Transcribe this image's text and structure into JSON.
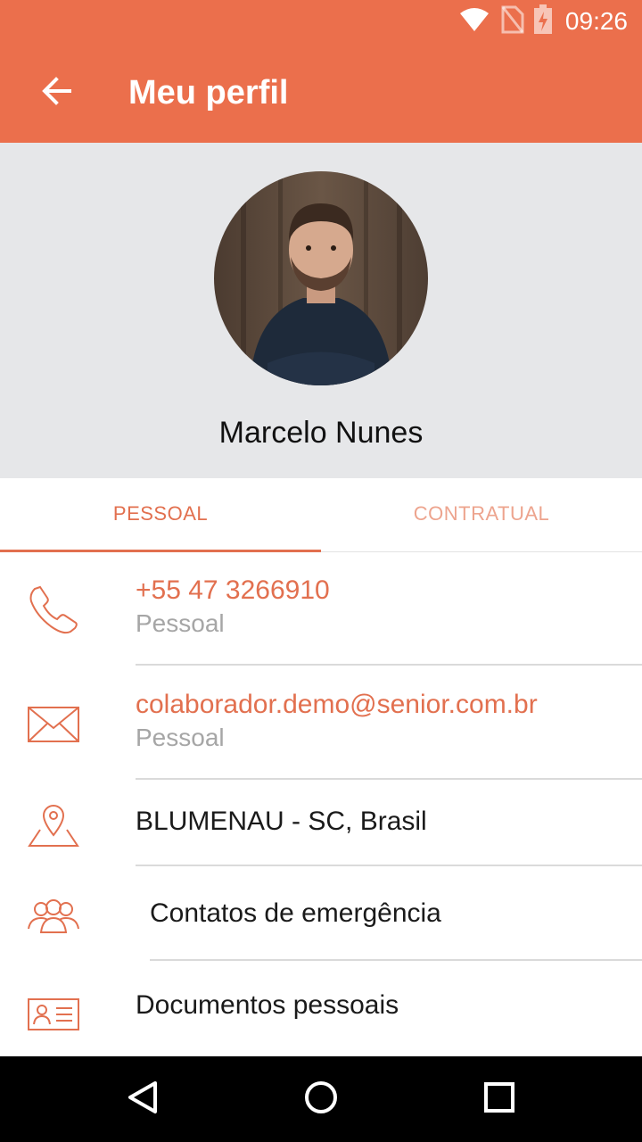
{
  "status_bar": {
    "time": "09:26",
    "icons": [
      "wifi-icon",
      "no-sim-icon",
      "battery-charging-icon"
    ]
  },
  "appbar": {
    "title": "Meu perfil",
    "back_icon": "arrow-left-icon"
  },
  "profile": {
    "name": "Marcelo Nunes"
  },
  "tabs": [
    {
      "label": "PESSOAL",
      "active": true
    },
    {
      "label": "CONTRATUAL",
      "active": false
    }
  ],
  "rows": {
    "phone": {
      "value": "+55 47 3266910",
      "type": "Pessoal",
      "icon": "phone-icon"
    },
    "email": {
      "value": "colaborador.demo@senior.com.br",
      "type": "Pessoal",
      "icon": "mail-icon"
    },
    "location": {
      "value": "BLUMENAU - SC, Brasil",
      "icon": "map-pin-icon"
    },
    "emergency": {
      "value": "Contatos de emergência",
      "icon": "people-icon"
    },
    "documents": {
      "value": "Documentos pessoais",
      "icon": "id-card-icon"
    }
  },
  "colors": {
    "accent": "#EB6F4C",
    "accent_text": "#E2704F",
    "profile_bg": "#E6E7E9"
  },
  "navbar": {
    "buttons": [
      "back-triangle-icon",
      "home-circle-icon",
      "recents-square-icon"
    ]
  }
}
